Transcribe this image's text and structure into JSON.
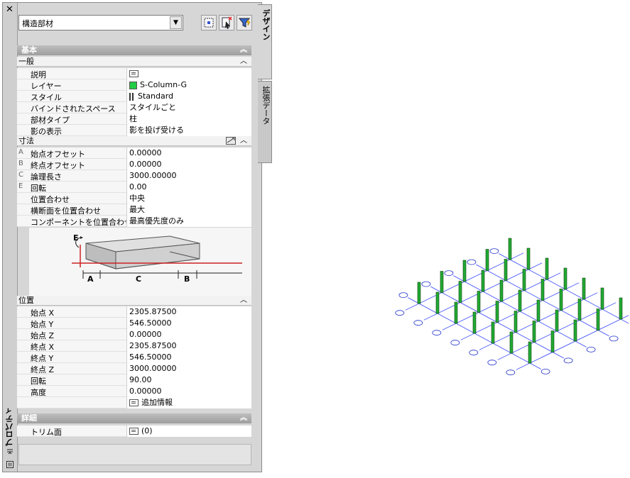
{
  "palette": {
    "close_glyph": "✕",
    "title": "プロパティ",
    "tabs": [
      {
        "label": "デザイン",
        "active": true
      },
      {
        "label": "拡張データ",
        "active": false
      }
    ],
    "style_combo": {
      "value": "構造部材"
    },
    "toolbar_icons": [
      "select-objects-icon",
      "pick-add-icon",
      "quick-select-filter-icon"
    ]
  },
  "sections": {
    "basic": {
      "title": "基本"
    },
    "general": {
      "title": "一般",
      "rows": [
        {
          "label": "説明",
          "value": "",
          "icon": "note-icon"
        },
        {
          "label": "レイヤー",
          "value": "S-Column-G",
          "icon": "color-swatch-icon",
          "color": "#22cc44"
        },
        {
          "label": "スタイル",
          "value": "Standard",
          "icon": "style-icon"
        },
        {
          "label": "バインドされたスペース",
          "value": "スタイルごと"
        },
        {
          "label": "部材タイプ",
          "value": "柱"
        },
        {
          "label": "影の表示",
          "value": "影を投げ受ける"
        }
      ]
    },
    "dimensions": {
      "title": "寸法",
      "rows": [
        {
          "key": "A",
          "label": "始点オフセット",
          "value": "0.00000"
        },
        {
          "key": "B",
          "label": "終点オフセット",
          "value": "0.00000"
        },
        {
          "key": "C",
          "label": "論理長さ",
          "value": "3000.00000"
        },
        {
          "key": "E",
          "label": "回転",
          "value": "0.00"
        },
        {
          "key": "",
          "label": "位置合わせ",
          "value": "中央"
        },
        {
          "key": "",
          "label": "横断面を位置合わせ",
          "value": "最大"
        },
        {
          "key": "",
          "label": "コンポーネントを位置合わせ",
          "value": "最高優先度のみ"
        }
      ],
      "diagram_labels": {
        "a": "A",
        "b": "B",
        "c": "C",
        "e": "E"
      }
    },
    "location": {
      "title": "位置",
      "rows": [
        {
          "label": "始点 X",
          "value": "2305.87500"
        },
        {
          "label": "始点 Y",
          "value": "546.50000"
        },
        {
          "label": "始点 Z",
          "value": "0.00000"
        },
        {
          "label": "終点 X",
          "value": "2305.87500"
        },
        {
          "label": "終点 Y",
          "value": "546.50000"
        },
        {
          "label": "終点 Z",
          "value": "3000.00000"
        },
        {
          "label": "回転",
          "value": "90.00"
        },
        {
          "label": "高度",
          "value": "0.00000"
        },
        {
          "label": "",
          "value": "追加情報",
          "icon": "note-icon"
        }
      ]
    },
    "details": {
      "title": "詳細",
      "rows": [
        {
          "label": "トリム面",
          "value": "(0)",
          "icon": "note-icon"
        }
      ]
    }
  },
  "colors": {
    "column": "#22aa33",
    "grid": "#3344ff",
    "bubble": "#2233cc"
  },
  "drawing": {
    "description_free": true,
    "columns_rows": 5,
    "columns_cols": 7
  }
}
